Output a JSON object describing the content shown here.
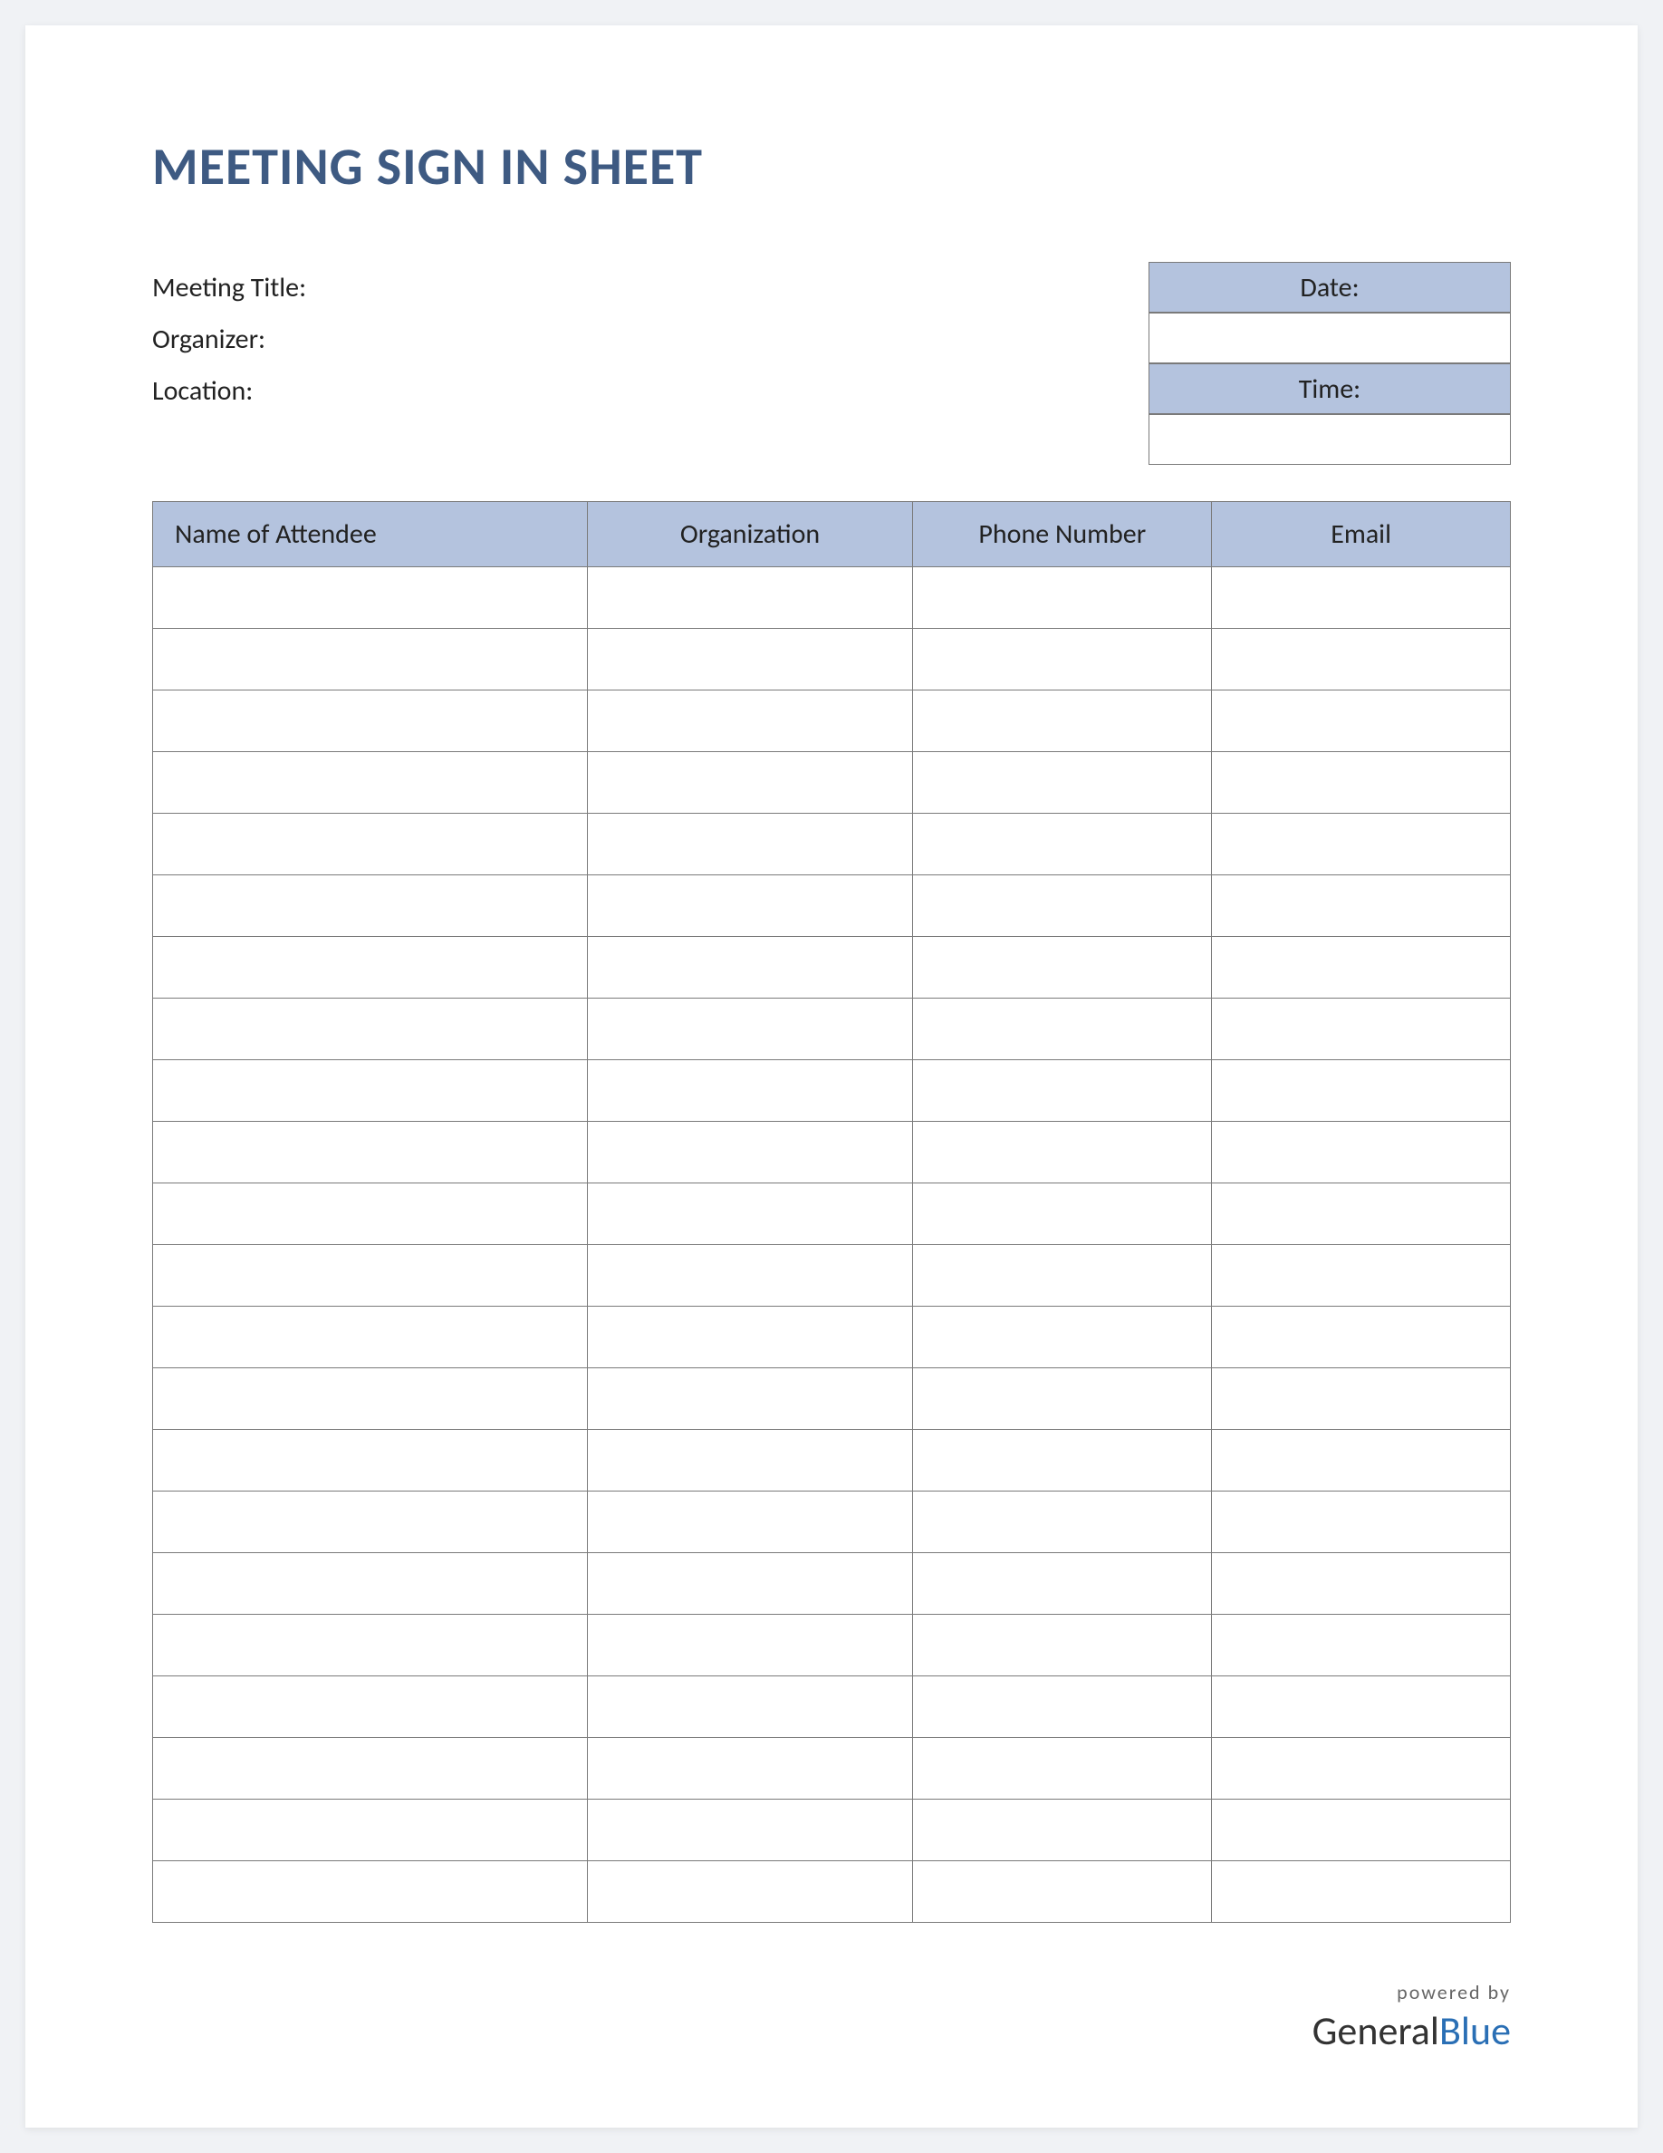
{
  "title": "MEETING SIGN IN SHEET",
  "meta": {
    "meeting_title_label": "Meeting Title:",
    "organizer_label": "Organizer:",
    "location_label": "Location:"
  },
  "datetime": {
    "date_label": "Date:",
    "date_value": "",
    "time_label": "Time:",
    "time_value": ""
  },
  "table": {
    "headers": {
      "name": "Name of Attendee",
      "organization": "Organization",
      "phone": "Phone Number",
      "email": "Email"
    },
    "row_count": 22
  },
  "footer": {
    "powered_by": "powered by",
    "brand_general": "General",
    "brand_blue": "Blue"
  }
}
